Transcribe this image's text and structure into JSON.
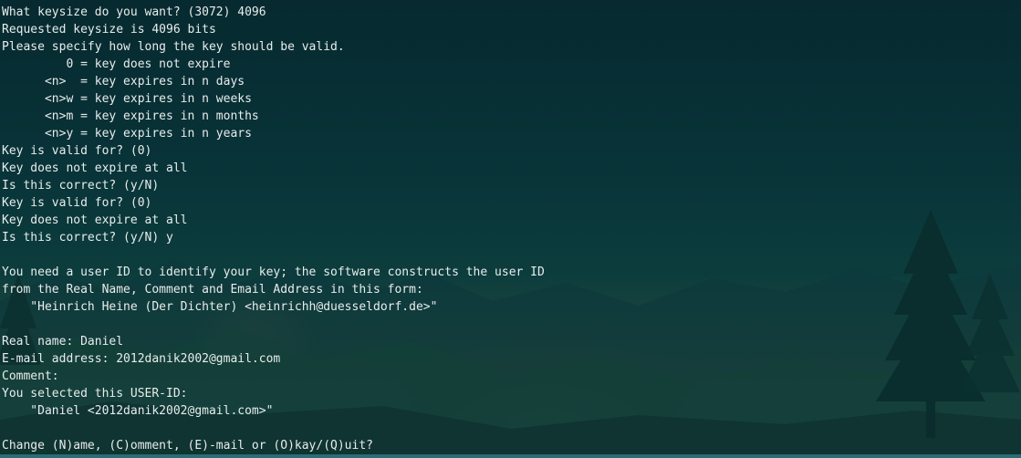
{
  "terminal": {
    "lines": [
      "What keysize do you want? (3072) 4096",
      "Requested keysize is 4096 bits",
      "Please specify how long the key should be valid.",
      "         0 = key does not expire",
      "      <n>  = key expires in n days",
      "      <n>w = key expires in n weeks",
      "      <n>m = key expires in n months",
      "      <n>y = key expires in n years",
      "Key is valid for? (0)",
      "Key does not expire at all",
      "Is this correct? (y/N)",
      "Key is valid for? (0)",
      "Key does not expire at all",
      "Is this correct? (y/N) y",
      "",
      "You need a user ID to identify your key; the software constructs the user ID",
      "from the Real Name, Comment and Email Address in this form:",
      "    \"Heinrich Heine (Der Dichter) <heinrichh@duesseldorf.de>\"",
      "",
      "Real name: Daniel",
      "E-mail address: 2012danik2002@gmail.com",
      "Comment:",
      "You selected this USER-ID:",
      "    \"Daniel <2012danik2002@gmail.com>\"",
      "",
      "Change (N)ame, (C)omment, (E)-mail or (O)kay/(Q)uit?"
    ]
  },
  "colors": {
    "text": "#e8ecec",
    "background": "#06262b"
  }
}
